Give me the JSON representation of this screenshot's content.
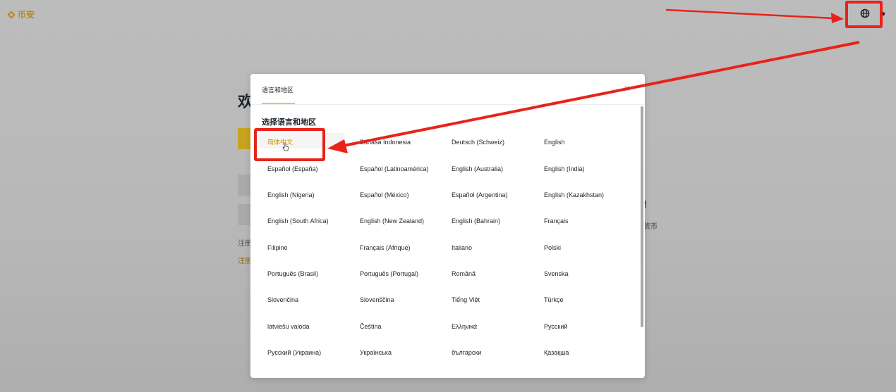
{
  "header": {
    "logo_text": "币安"
  },
  "background": {
    "title": "欢",
    "small1": "注册",
    "small2": "注册",
    "right_mark": "!",
    "right_text": "货币"
  },
  "modal": {
    "tab_label": "语言和地区",
    "section_title": "选择语言和地区",
    "close_glyph": "×",
    "languages": [
      "简体中文",
      "Bahasa Indonesia",
      "Deutsch (Schweiz)",
      "English",
      "Español (España)",
      "Español (Latinoamérica)",
      "English (Australia)",
      "English (India)",
      "English (Nigeria)",
      "Español (México)",
      "Español (Argentina)",
      "English (Kazakhstan)",
      "English (South Africa)",
      "English (New Zealand)",
      "English (Bahrain)",
      "Français",
      "Filipino",
      "Français (Afrique)",
      "Italiano",
      "Polski",
      "Português (Brasil)",
      "Português (Portugal)",
      "Română",
      "Svenska",
      "Slovenčina",
      "Slovenščina",
      "Tiếng Việt",
      "Türkçe",
      "latviešu valoda",
      "Čeština",
      "Ελληνικά",
      "Русский",
      "Русский (Украина)",
      "Українська",
      "български",
      "Қазақша"
    ],
    "selected_index": 0
  },
  "icons": {
    "logo": "binance-logo-icon",
    "globe": "globe-icon",
    "close": "close-icon",
    "cursor": "hand-cursor-icon"
  },
  "colors": {
    "accent": "#C99400",
    "annotation": "#E8231A"
  }
}
